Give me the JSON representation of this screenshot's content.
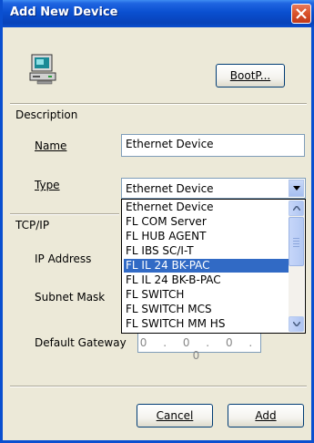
{
  "window": {
    "title": "Add New Device"
  },
  "icons": {
    "close": "close-icon",
    "device": "computer-icon",
    "dropdown": "chevron-down-icon"
  },
  "buttons": {
    "bootp": "BootP...",
    "cancel": "Cancel",
    "add": "Add"
  },
  "description": {
    "section_label": "Description",
    "name_label": "Name",
    "name_value": "Ethernet Device",
    "type_label": "Type",
    "type_value": "Ethernet Device"
  },
  "tcpip": {
    "section_label": "TCP/IP",
    "ip_label": "IP Address",
    "subnet_label": "Subnet Mask",
    "gateway_label": "Default Gateway",
    "gateway_value": "0 . 0 . 0 . 0"
  },
  "type_dropdown": {
    "items": [
      "Ethernet Device",
      "FL COM Server",
      "FL HUB AGENT",
      "FL IBS SC/I-T",
      "FL IL 24 BK-PAC",
      "FL IL 24 BK-B-PAC",
      "FL SWITCH",
      "FL SWITCH MCS",
      "FL SWITCH MM HS"
    ],
    "selected_index": 4
  },
  "colors": {
    "title_bar": "#0a4fd0",
    "selection": "#316ac5",
    "dialog_bg": "#ece9d8"
  }
}
